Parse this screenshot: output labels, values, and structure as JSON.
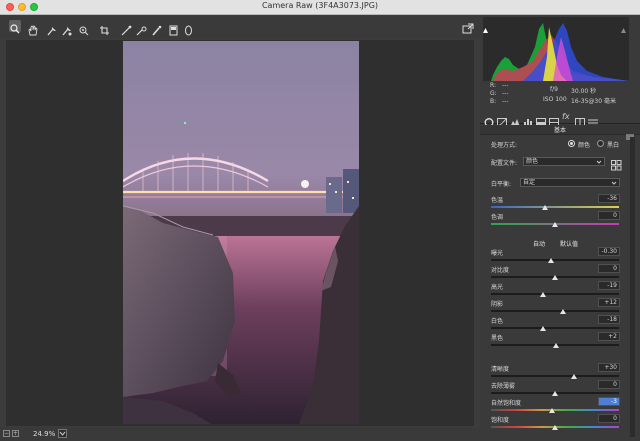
{
  "window": {
    "title": "Camera Raw (3F4A3073.JPG)"
  },
  "toolbar": {
    "tools": [
      "zoom-icon",
      "hand-icon",
      "white-balance-icon",
      "color-sampler-icon",
      "target-adjust-icon",
      "crop-icon",
      "straighten-icon",
      "spot-removal-icon",
      "brush-icon",
      "graduated-filter-icon",
      "radial-filter-icon"
    ],
    "export_icon": "open-preferences-icon"
  },
  "status": {
    "zoom": "24.9%"
  },
  "info": {
    "r_label": "R:",
    "r_val": "---",
    "g_label": "G:",
    "g_val": "---",
    "b_label": "B:",
    "b_val": "---",
    "aperture": "f/9",
    "shutter": "30.00 秒",
    "iso": "ISO 100",
    "lens": "16-35@30 毫米"
  },
  "panel": {
    "header": "基本",
    "treatment_label": "处理方式:",
    "color_option": "颜色",
    "bw_option": "黑白",
    "profile_label": "配置文件:",
    "profile_value": "颜色",
    "wb_label": "白平衡:",
    "wb_value": "自定",
    "auto": "自动",
    "default": "默认值"
  },
  "sliders": [
    {
      "label": "色温",
      "value": "-36",
      "pos": 0.42
    },
    {
      "label": "色调",
      "value": "0",
      "pos": 0.5
    },
    {
      "label": "曝光",
      "value": "-0.30",
      "pos": 0.47
    },
    {
      "label": "对比度",
      "value": "0",
      "pos": 0.5
    },
    {
      "label": "高光",
      "value": "-19",
      "pos": 0.41
    },
    {
      "label": "阴影",
      "value": "+12",
      "pos": 0.56
    },
    {
      "label": "白色",
      "value": "-18",
      "pos": 0.41
    },
    {
      "label": "黑色",
      "value": "+2",
      "pos": 0.51
    },
    {
      "label": "清晰度",
      "value": "+30",
      "pos": 0.65
    },
    {
      "label": "去除薄雾",
      "value": "0",
      "pos": 0.5
    },
    {
      "label": "自然饱和度",
      "value": "-3",
      "pos": 0.48
    },
    {
      "label": "饱和度",
      "value": "0",
      "pos": 0.5
    }
  ],
  "colors": {
    "accent": "#4e7fd6",
    "panel_bg": "#3a3a3a",
    "titlebar": "#e2e2e2"
  }
}
